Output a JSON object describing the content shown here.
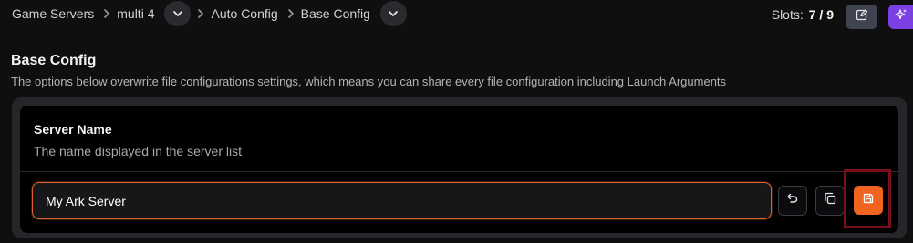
{
  "breadcrumb": {
    "items": [
      {
        "label": "Game Servers"
      },
      {
        "label": "multi 4"
      },
      {
        "label": "Auto Config"
      },
      {
        "label": "Base Config"
      }
    ]
  },
  "header": {
    "slots_label": "Slots:",
    "slots_value": "7 / 9"
  },
  "section": {
    "title": "Base Config",
    "description": "The options below overwrite file configurations settings, which means you can share every file configuration including Launch Arguments"
  },
  "field": {
    "title": "Server Name",
    "description": "The name displayed in the server list",
    "value": "My Ark Server"
  },
  "icons": {
    "crumb_dropdown": "chevron-down-icon",
    "crumb_separator": "chevron-right-icon",
    "edit": "edit-icon",
    "magic": "sparkles-icon",
    "undo": "undo-icon",
    "copy": "copy-icon",
    "save": "save-icon"
  },
  "colors": {
    "accent": "#f0641f",
    "magic": "#7b3fe4",
    "highlight": "#7a0f1c"
  }
}
